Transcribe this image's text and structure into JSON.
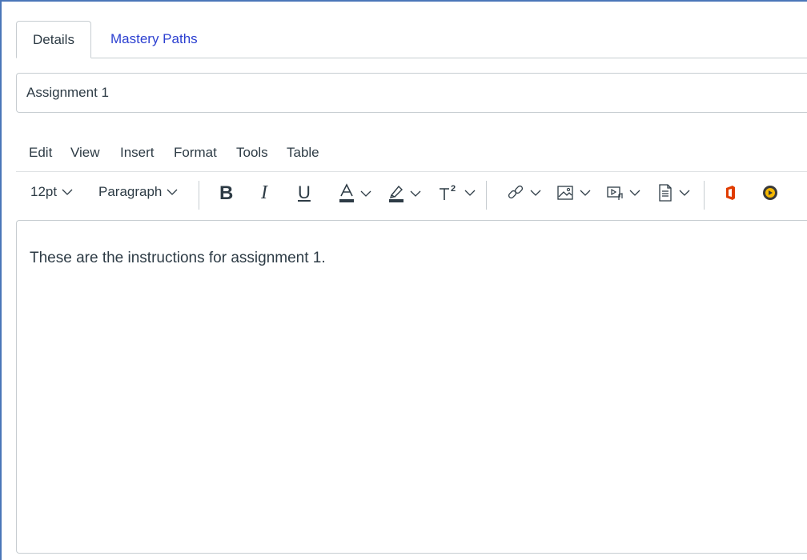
{
  "tabs": [
    {
      "label": "Details",
      "active": true
    },
    {
      "label": "Mastery Paths",
      "active": false
    }
  ],
  "title_input": {
    "value": "Assignment 1"
  },
  "menubar": [
    "Edit",
    "View",
    "Insert",
    "Format",
    "Tools",
    "Table"
  ],
  "toolbar": {
    "font_size": "12pt",
    "block_format": "Paragraph",
    "bold_glyph": "B",
    "italic_glyph": "I",
    "underline_glyph": "U",
    "icons": [
      "bold-icon",
      "italic-icon",
      "underline-icon",
      "text-color-icon",
      "highlight-icon",
      "superscript-icon",
      "link-icon",
      "image-icon",
      "media-icon",
      "document-icon",
      "office365-icon",
      "media-record-icon"
    ]
  },
  "editor": {
    "body_text": "These are the instructions for assignment 1."
  },
  "colors": {
    "link_blue": "#2b3fd0",
    "frame_blue": "#4a76b8",
    "office_orange": "#e03c00",
    "media_yellow": "#f5b800"
  }
}
